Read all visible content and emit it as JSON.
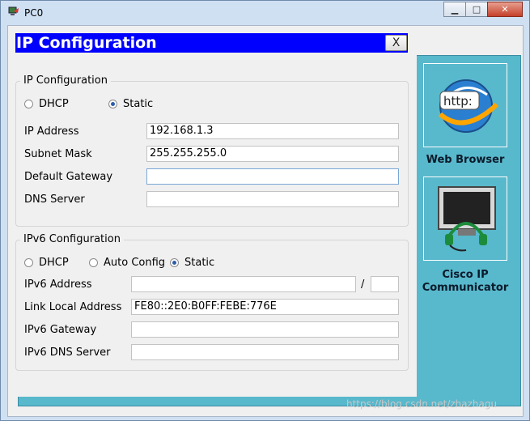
{
  "window": {
    "title": "PC0",
    "minimize_glyph": "▁",
    "maximize_glyph": "□",
    "close_glyph": "✕"
  },
  "dialog": {
    "title": "IP Configuration",
    "close_label": "X"
  },
  "ipv4": {
    "legend": "IP Configuration",
    "dhcp_label": "DHCP",
    "static_label": "Static",
    "selected": "Static",
    "ip_address_label": "IP Address",
    "ip_address": "192.168.1.3",
    "subnet_mask_label": "Subnet Mask",
    "subnet_mask": "255.255.255.0",
    "gateway_label": "Default Gateway",
    "gateway": "",
    "dns_label": "DNS Server",
    "dns": ""
  },
  "ipv6": {
    "legend": "IPv6 Configuration",
    "dhcp_label": "DHCP",
    "auto_label": "Auto Config",
    "static_label": "Static",
    "selected": "Static",
    "address_label": "IPv6 Address",
    "address": "",
    "prefix_separator": "/",
    "prefix": "",
    "link_local_label": "Link Local Address",
    "link_local": "FE80::2E0:B0FF:FEBE:776E",
    "gateway_label": "IPv6 Gateway",
    "gateway": "",
    "dns_label": "IPv6 DNS Server",
    "dns": ""
  },
  "desktop": {
    "web_browser_label": "Web Browser",
    "web_browser_icon_text": "http:",
    "cisco_ip_label_line1": "Cisco IP",
    "cisco_ip_label_line2": "Communicator"
  },
  "watermark": "https://blog.csdn.net/zhazhagu"
}
